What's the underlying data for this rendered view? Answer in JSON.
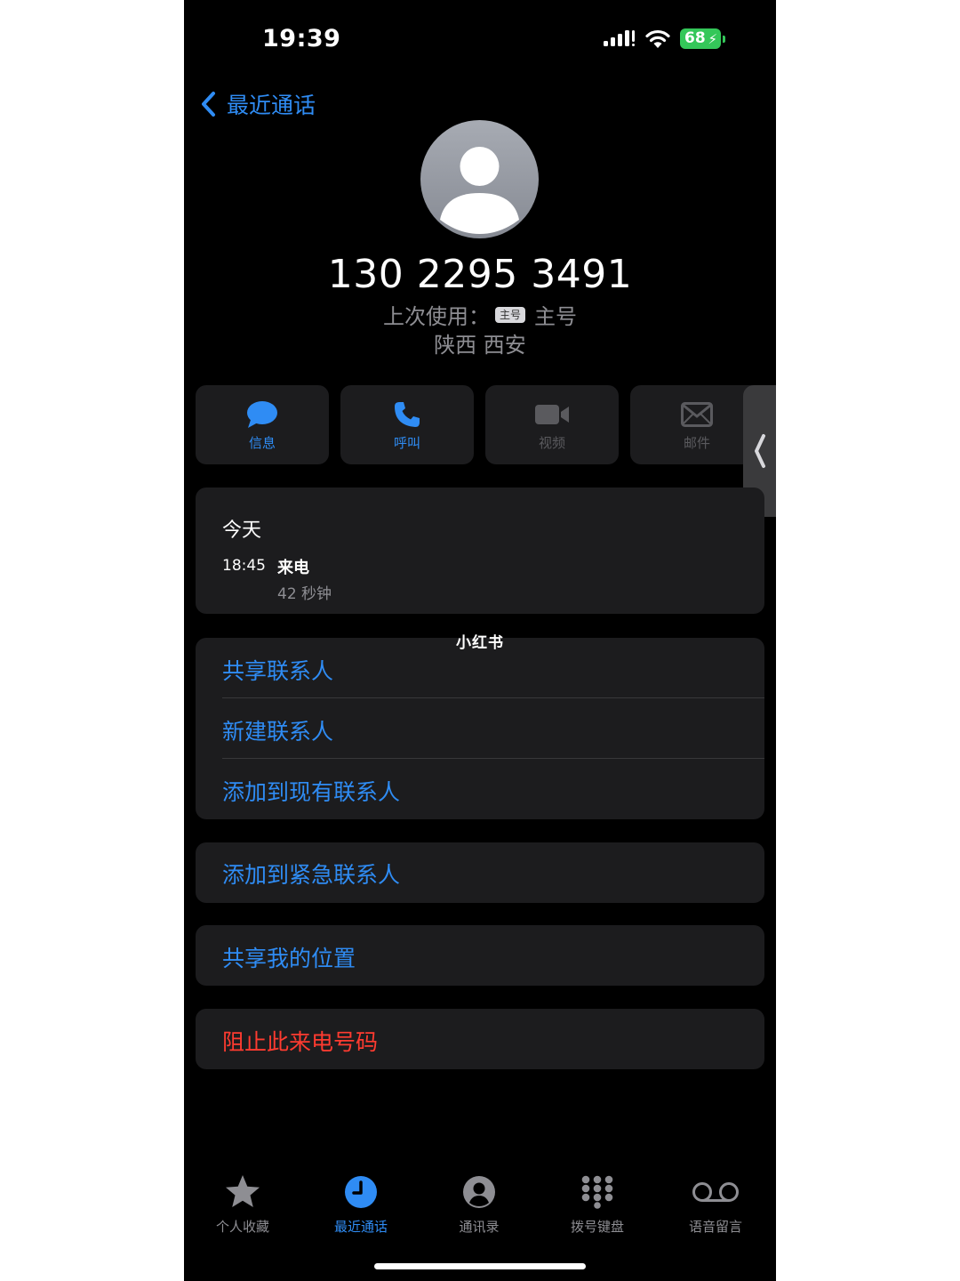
{
  "status_bar": {
    "time": "19:39",
    "battery": "68"
  },
  "nav": {
    "back_label": "最近通话"
  },
  "contact": {
    "number": "130 2295 3491",
    "last_used_label": "上次使用：",
    "sim_badge": "主号",
    "sim_name": "主号",
    "location": "陕西 西安"
  },
  "actions": [
    {
      "label": "信息",
      "icon": "message-bubble-icon",
      "enabled": true
    },
    {
      "label": "呼叫",
      "icon": "phone-icon",
      "enabled": true
    },
    {
      "label": "视频",
      "icon": "video-camera-icon",
      "enabled": false
    },
    {
      "label": "邮件",
      "icon": "envelope-icon",
      "enabled": false
    }
  ],
  "call_log": {
    "date": "今天",
    "time": "18:45",
    "type": "来电",
    "duration": "42 秒钟"
  },
  "watermark": "小红书",
  "contact_options": [
    "共享联系人",
    "新建联系人",
    "添加到现有联系人"
  ],
  "emergency_option": "添加到紧急联系人",
  "location_option": "共享我的位置",
  "block_option": "阻止此来电号码",
  "tab_bar": [
    {
      "label": "个人收藏",
      "icon": "star-icon",
      "active": false
    },
    {
      "label": "最近通话",
      "icon": "clock-icon",
      "active": true
    },
    {
      "label": "通讯录",
      "icon": "person-circle-icon",
      "active": false
    },
    {
      "label": "拨号键盘",
      "icon": "keypad-icon",
      "active": false
    },
    {
      "label": "语音留言",
      "icon": "voicemail-icon",
      "active": false
    }
  ],
  "colors": {
    "accent": "#2f8cf4",
    "destructive": "#ff3b30",
    "card": "#1c1c1e",
    "background": "#000000",
    "battery": "#34c759"
  }
}
